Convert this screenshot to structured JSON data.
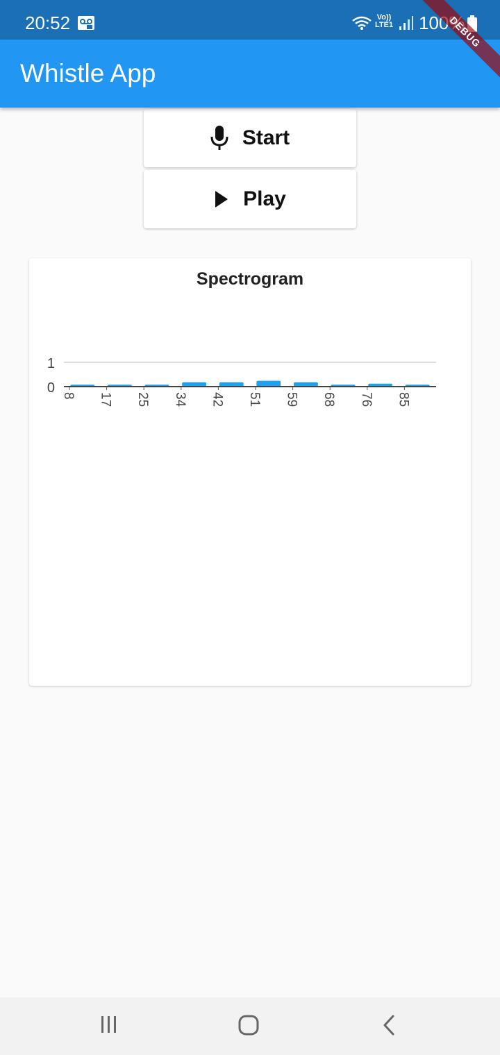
{
  "status_bar": {
    "time": "20:52",
    "volte_line1": "Vo))",
    "volte_line2": "LTE1",
    "battery": "100%",
    "icons": [
      "voicemail-icon",
      "wifi-icon",
      "volte-icon",
      "signal-icon",
      "battery-icon"
    ]
  },
  "debug_banner": "DEBUG",
  "app_bar": {
    "title": "Whistle App",
    "color": "#2196f3"
  },
  "buttons": {
    "start": {
      "label": "Start",
      "icon": "microphone-icon"
    },
    "play": {
      "label": "Play",
      "icon": "play-icon"
    }
  },
  "chart_data": {
    "type": "bar",
    "title": "Spectrogram",
    "xlabel": "",
    "ylabel": "",
    "categories": [
      "8",
      "17",
      "25",
      "34",
      "42",
      "51",
      "59",
      "68",
      "76",
      "85"
    ],
    "values": [
      0.08,
      0.08,
      0.08,
      0.18,
      0.18,
      0.24,
      0.18,
      0.08,
      0.12,
      0.08
    ],
    "y_ticks": [
      "0",
      "1"
    ],
    "ylim": [
      0,
      1
    ],
    "grid": true,
    "bar_color": "#1ea1f0"
  },
  "nav_bar": {
    "icons": [
      "recent-apps-icon",
      "home-icon",
      "back-icon"
    ]
  }
}
